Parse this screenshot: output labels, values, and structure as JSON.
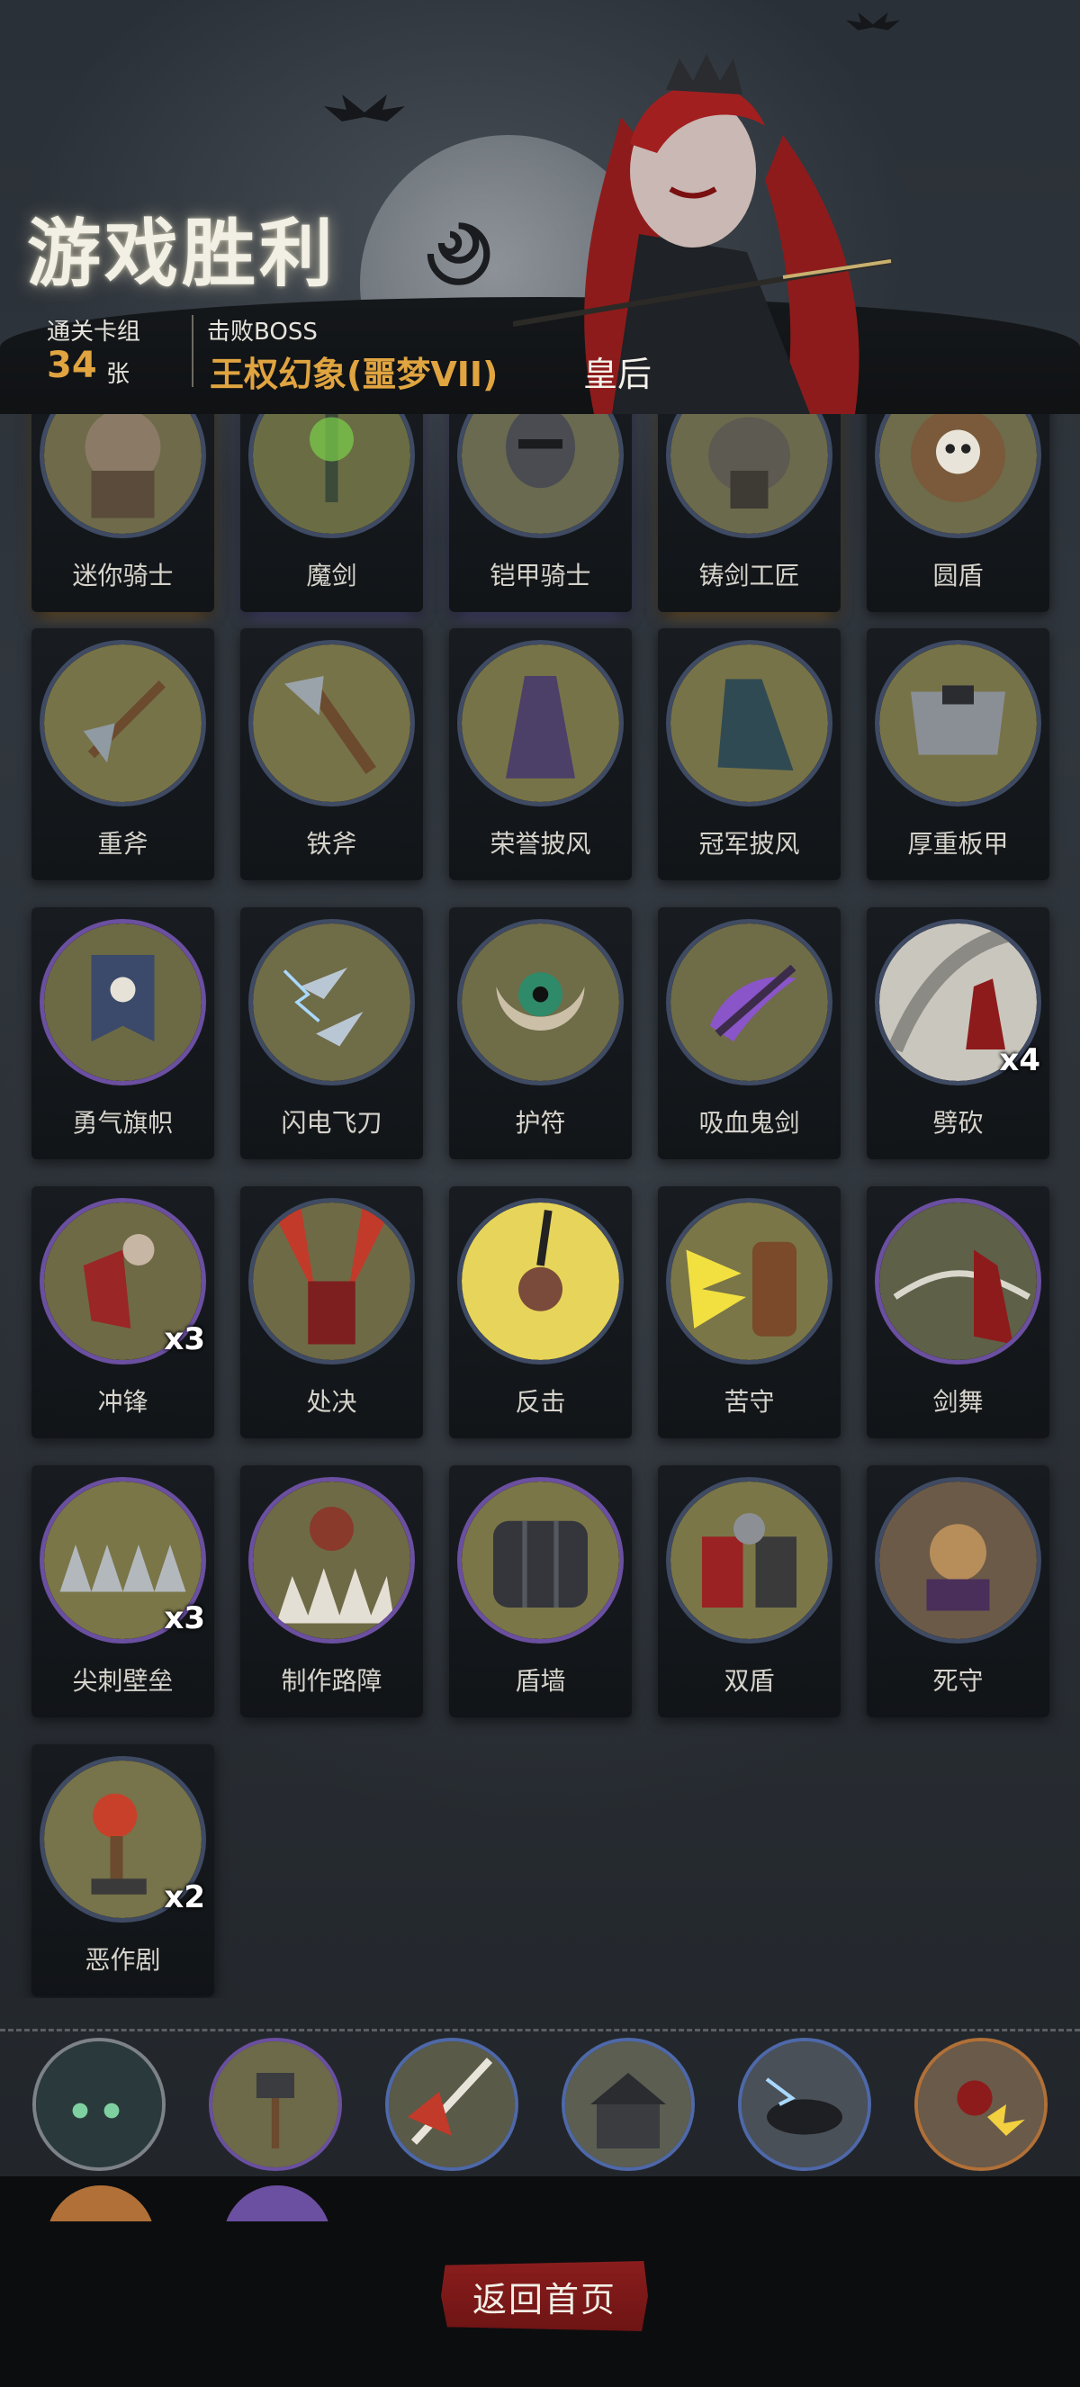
{
  "header": {
    "title": "游戏胜利",
    "deck_label": "通关卡组",
    "deck_count": "34",
    "deck_unit": "张",
    "boss_label": "击败BOSS",
    "boss_name": "王权幻象(噩梦VII)",
    "boss_tag": "皇后"
  },
  "cards": [
    {
      "label": "迷你骑士",
      "icon": "mini-knight-icon",
      "count": ""
    },
    {
      "label": "魔剑",
      "icon": "magic-sword-icon",
      "count": ""
    },
    {
      "label": "铠甲骑士",
      "icon": "armored-knight-icon",
      "count": ""
    },
    {
      "label": "铸剑工匠",
      "icon": "swordsmith-icon",
      "count": ""
    },
    {
      "label": "圆盾",
      "icon": "round-shield-icon",
      "count": ""
    },
    {
      "label": "重斧",
      "icon": "heavy-axe-icon",
      "count": ""
    },
    {
      "label": "铁斧",
      "icon": "iron-axe-icon",
      "count": ""
    },
    {
      "label": "荣誉披风",
      "icon": "honor-cloak-icon",
      "count": ""
    },
    {
      "label": "冠军披风",
      "icon": "champion-cloak-icon",
      "count": ""
    },
    {
      "label": "厚重板甲",
      "icon": "plate-armor-icon",
      "count": ""
    },
    {
      "label": "勇气旗帜",
      "icon": "courage-banner-icon",
      "count": ""
    },
    {
      "label": "闪电飞刀",
      "icon": "lightning-knife-icon",
      "count": ""
    },
    {
      "label": "护符",
      "icon": "amulet-icon",
      "count": ""
    },
    {
      "label": "吸血鬼剑",
      "icon": "vampire-sword-icon",
      "count": ""
    },
    {
      "label": "劈砍",
      "icon": "slash-icon",
      "count": "x4"
    },
    {
      "label": "冲锋",
      "icon": "charge-icon",
      "count": "x3"
    },
    {
      "label": "处决",
      "icon": "execute-icon",
      "count": ""
    },
    {
      "label": "反击",
      "icon": "counter-icon",
      "count": ""
    },
    {
      "label": "苦守",
      "icon": "hold-fast-icon",
      "count": ""
    },
    {
      "label": "剑舞",
      "icon": "sword-dance-icon",
      "count": ""
    },
    {
      "label": "尖刺壁垒",
      "icon": "spike-barrier-icon",
      "count": "x3"
    },
    {
      "label": "制作路障",
      "icon": "barricade-icon",
      "count": ""
    },
    {
      "label": "盾墙",
      "icon": "shield-wall-icon",
      "count": ""
    },
    {
      "label": "双盾",
      "icon": "double-shield-icon",
      "count": ""
    },
    {
      "label": "死守",
      "icon": "last-stand-icon",
      "count": ""
    },
    {
      "label": "恶作剧",
      "icon": "prank-icon",
      "count": ""
    }
  ],
  "card_counts_extra": {
    "prank": "x2"
  },
  "relics": [
    "relic-graveyard-icon",
    "relic-hammer-icon",
    "relic-blade-icon",
    "relic-village-icon",
    "relic-panther-icon",
    "relic-queen-icon"
  ],
  "footer": {
    "home_button": "返回首页"
  }
}
